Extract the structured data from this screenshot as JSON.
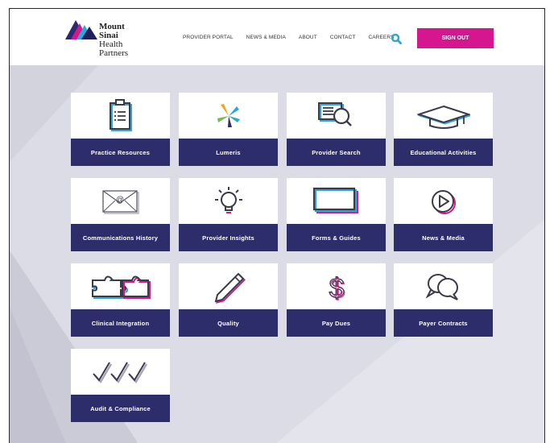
{
  "brand": {
    "line1": "Mount",
    "line2": "Sinai",
    "line3": "Health",
    "line4": "Partners"
  },
  "nav": {
    "items": [
      "PROVIDER PORTAL",
      "NEWS & MEDIA",
      "ABOUT",
      "CONTACT",
      "CAREERS"
    ],
    "search_icon": "search-icon",
    "signout_label": "SIGN OUT"
  },
  "colors": {
    "accent": "#d6168e",
    "label_bar": "#2e2d6b",
    "background": "#dcdce6",
    "icon_blue": "#2ea6d8"
  },
  "tiles": [
    {
      "label": "Practice Resources",
      "icon": "clipboard-icon"
    },
    {
      "label": "Lumeris",
      "icon": "lumeris-logo-icon"
    },
    {
      "label": "Provider Search",
      "icon": "document-search-icon"
    },
    {
      "label": "Educational Activities",
      "icon": "graduation-cap-icon"
    },
    {
      "label": "Communications History",
      "icon": "envelope-icon"
    },
    {
      "label": "Provider Insights",
      "icon": "lightbulb-icon"
    },
    {
      "label": "Forms & Guides",
      "icon": "forms-frame-icon"
    },
    {
      "label": "News & Media",
      "icon": "play-icon"
    },
    {
      "label": "Clinical Integration",
      "icon": "puzzle-icon"
    },
    {
      "label": "Quality",
      "icon": "pencil-icon"
    },
    {
      "label": "Pay Dues",
      "icon": "dollar-icon"
    },
    {
      "label": "Payer Contracts",
      "icon": "chat-bubbles-icon"
    },
    {
      "label": "Audit & Compliance",
      "icon": "checkmarks-icon"
    }
  ]
}
